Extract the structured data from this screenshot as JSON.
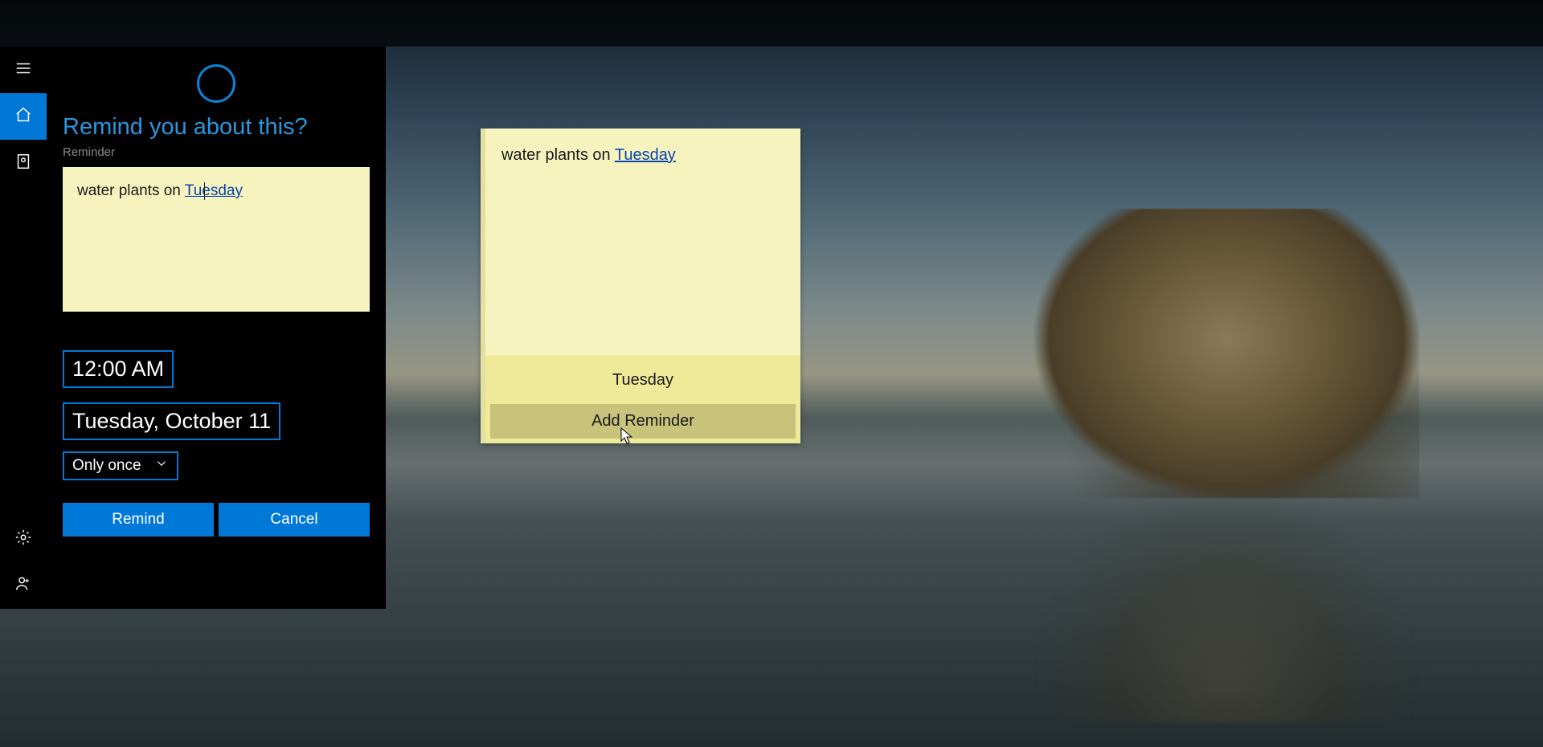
{
  "cortana": {
    "heading": "Remind you about this?",
    "reminder_label": "Reminder",
    "note_prefix": "water plants on ",
    "note_link": "Tuesday",
    "time_value": "12:00 AM",
    "date_value": "Tuesday, October 11",
    "repeat_value": "Only once",
    "remind_label": "Remind",
    "cancel_label": "Cancel"
  },
  "sticky_note": {
    "text_prefix": "water plants on ",
    "text_link": "Tuesday",
    "suggestion_day": "Tuesday",
    "add_reminder_label": "Add Reminder"
  }
}
